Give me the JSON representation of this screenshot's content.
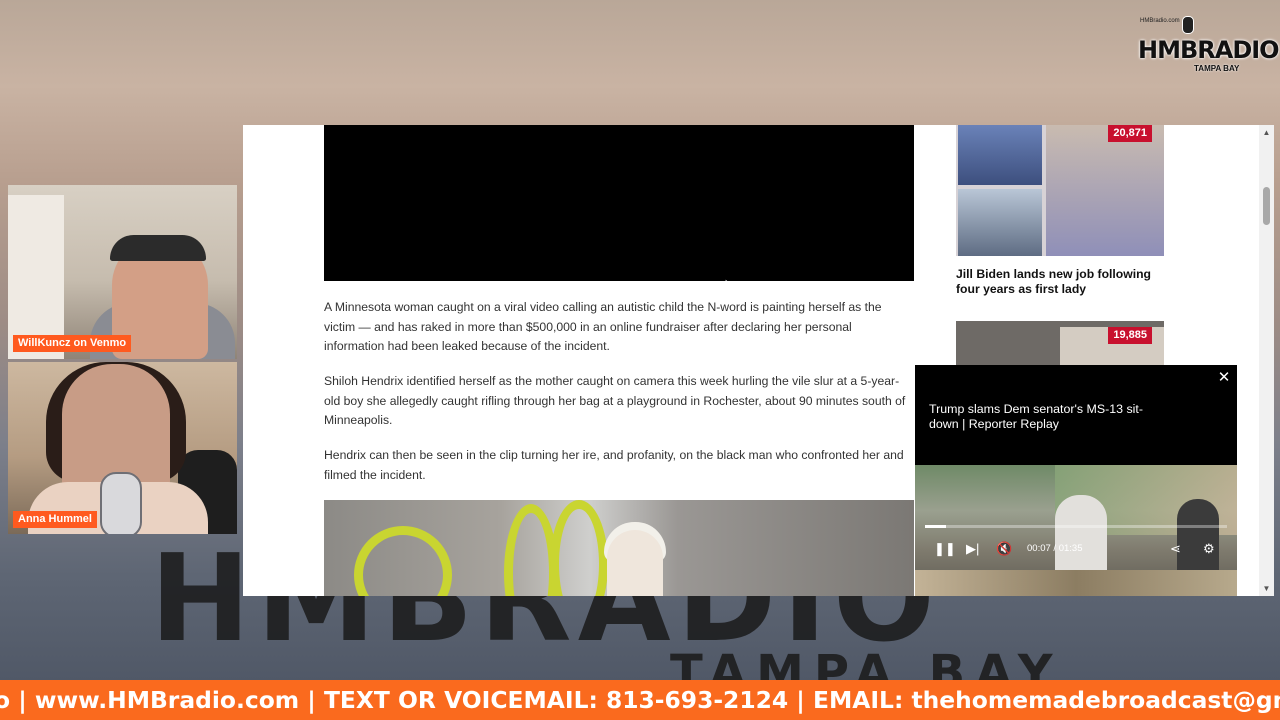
{
  "branding": {
    "logo_main": "HMBRADIO",
    "logo_sub": "TAMPA BAY",
    "logo_tiny": "HMBradio.com",
    "background_logo": "HMBRADIO",
    "background_logo_sub": "TAMPA BAY"
  },
  "article": {
    "paragraphs": [
      "A Minnesota woman caught on a viral video calling an autistic child the N-word is painting herself as the victim — and has raked in more than $500,000 in an online fundraiser after declaring her personal information had been leaked because of the incident.",
      "Shiloh Hendrix identified herself as the mother caught on camera this week hurling the vile slur at a 5-year-old boy she allegedly caught rifling through her bag at a playground in Rochester, about 90 minutes south of Minneapolis.",
      "Hendrix can then be seen in the clip turning her ire, and profanity, on the black man who confronted her and filmed the incident."
    ]
  },
  "sidebar": {
    "story1": {
      "count": "20,871",
      "headline": "Jill Biden lands new job following four years as first lady"
    },
    "story2": {
      "count": "19,885"
    }
  },
  "popup_player": {
    "title": "Trump slams Dem senator's MS-13 sit-down | Reporter Replay",
    "close_icon": "close-icon",
    "current_time": "00:07",
    "duration": "01:35",
    "time_separator": "/",
    "progress": 0.07
  },
  "cameras": {
    "cam1_label": "WillKuncz on Venmo",
    "cam2_label": "Anna Hummel"
  },
  "ticker": {
    "text": "o | www.HMBradio.com | TEXT OR VOICEMAIL: 813-693-2124 | EMAIL: thehomemadebroadcast@gmail.com"
  },
  "colors": {
    "ticker_bg": "#fa6a1e",
    "label_bg": "#ff5a1f",
    "badge_bg": "#c8102e"
  }
}
